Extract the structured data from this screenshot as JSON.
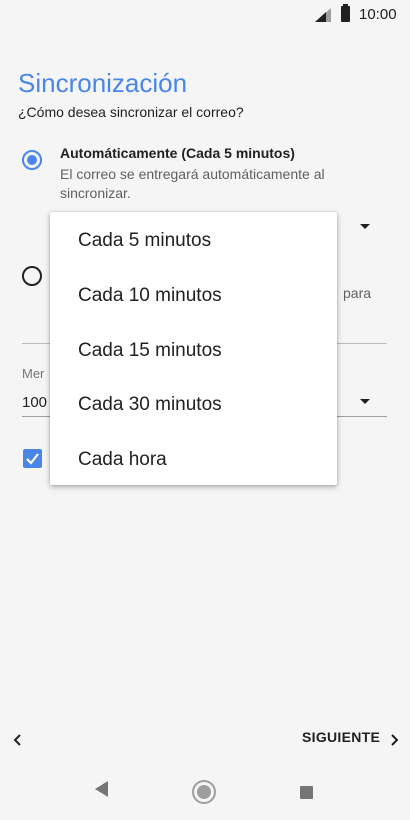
{
  "status_bar": {
    "time": "10:00",
    "icons": [
      "signal-icon",
      "battery-icon"
    ]
  },
  "header": {
    "title": "Sincronización",
    "subtitle": "¿Cómo desea sincronizar el correo?"
  },
  "sync_options": {
    "automatic": {
      "title": "Automáticamente (Cada 5 minutos)",
      "description": "El correo se entregará automáticamente al sincronizar.",
      "selected": true
    },
    "manual": {
      "partial_text": "para",
      "selected": false
    }
  },
  "below_menu": {
    "field_label_partial": "Mer",
    "field_value_partial": "100",
    "checkbox_checked": true
  },
  "dropdown": {
    "items": [
      "Cada 5 minutos",
      "Cada 10 minutos",
      "Cada 15 minutos",
      "Cada 30 minutos",
      "Cada hora"
    ]
  },
  "footer": {
    "next_label": "SIGUIENTE"
  },
  "colors": {
    "accent": "#4a86e8",
    "background": "#f5f5f5"
  }
}
